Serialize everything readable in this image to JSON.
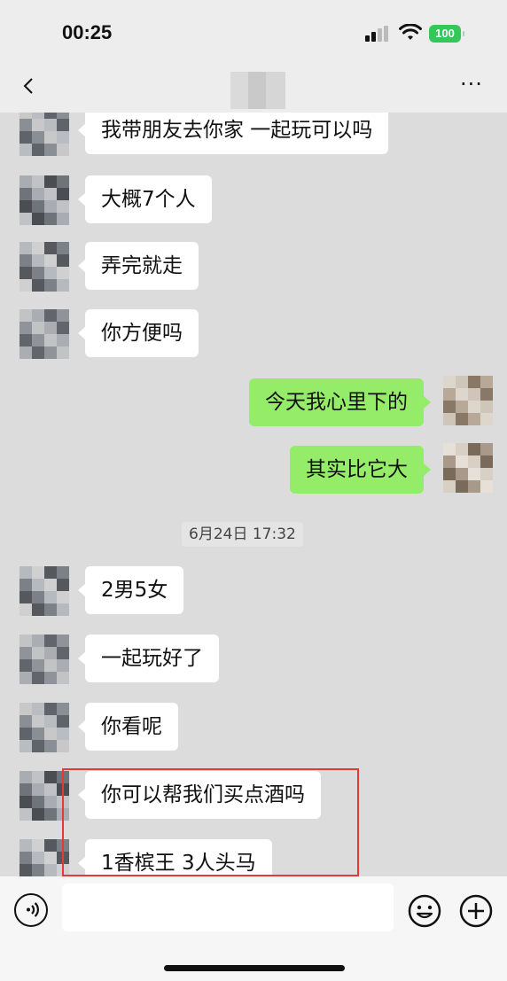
{
  "status_bar": {
    "time": "00:25",
    "battery": "100"
  },
  "nav": {
    "back_icon": "chevron-left-icon",
    "more_icon": "more-icon",
    "more_label": "···"
  },
  "messages": [
    {
      "side": "left",
      "text": "我带朋友去你家 一起玩可以吗"
    },
    {
      "side": "left",
      "text": "大概7个人"
    },
    {
      "side": "left",
      "text": "弄完就走"
    },
    {
      "side": "left",
      "text": "你方便吗"
    },
    {
      "side": "right",
      "text": "今天我心里下的"
    },
    {
      "side": "right",
      "text": "其实比它大"
    },
    {
      "side": "left",
      "text": "2男5女"
    },
    {
      "side": "left",
      "text": "一起玩好了"
    },
    {
      "side": "left",
      "text": "你看呢"
    },
    {
      "side": "left",
      "text": "你可以帮我们买点酒吗"
    },
    {
      "side": "left",
      "text": "1香槟王 3人头马"
    }
  ],
  "timestamp": "6月24日 17:32",
  "input_bar": {
    "voice_icon": "voice-icon",
    "emoji_icon": "emoji-icon",
    "plus_icon": "plus-icon",
    "input_value": ""
  },
  "colors": {
    "self_bubble": "#95ec69",
    "other_bubble": "#ffffff",
    "highlight": "#e53935",
    "battery": "#34c759"
  }
}
